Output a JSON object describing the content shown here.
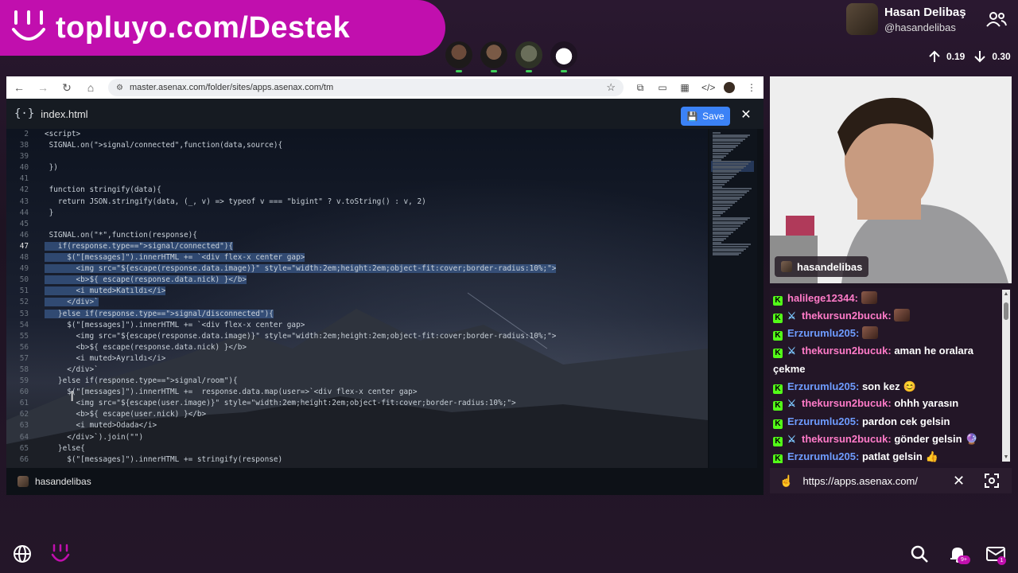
{
  "banner": {
    "text": "topluyo.com/Destek"
  },
  "profile": {
    "name": "Hasan Delibaş",
    "handle": "@hasandelibas"
  },
  "votes": {
    "up": "0.19",
    "down": "0.30"
  },
  "browser": {
    "address": "master.asenax.com/folder/sites/apps.asenax.com/tm",
    "file_name": "index.html",
    "save_label": "Save",
    "bottom_user": "hasandelibas"
  },
  "code_lines": [
    {
      "n": "2",
      "t": "<script>",
      "sel": false
    },
    {
      "n": "38",
      "t": " SIGNAL.on(\">signal/connected\",function(data,source){",
      "sel": false
    },
    {
      "n": "39",
      "t": "",
      "sel": false
    },
    {
      "n": "40",
      "t": " })",
      "sel": false
    },
    {
      "n": "41",
      "t": "",
      "sel": false
    },
    {
      "n": "42",
      "t": " function stringify(data){",
      "sel": false
    },
    {
      "n": "43",
      "t": "   return JSON.stringify(data, (_, v) => typeof v === \"bigint\" ? v.toString() : v, 2)",
      "sel": false
    },
    {
      "n": "44",
      "t": " }",
      "sel": false
    },
    {
      "n": "45",
      "t": "",
      "sel": false
    },
    {
      "n": "46",
      "t": " SIGNAL.on(\"*\",function(response){",
      "sel": false
    },
    {
      "n": "47",
      "t": "   if(response.type==\">signal/connected\"){",
      "sel": true
    },
    {
      "n": "48",
      "t": "     $(\"[messages]\").innerHTML += `<div flex-x center gap>",
      "sel": true
    },
    {
      "n": "49",
      "t": "       <img src=\"${escape(response.data.image)}\" style=\"width:2em;height:2em;object-fit:cover;border-radius:10%;\">",
      "sel": true
    },
    {
      "n": "50",
      "t": "       <b>${ escape(response.data.nick) }</b>",
      "sel": true
    },
    {
      "n": "51",
      "t": "       <i muted>Katıldı</i>",
      "sel": true
    },
    {
      "n": "52",
      "t": "     </div>`",
      "sel": true
    },
    {
      "n": "53",
      "t": "   }else if(response.type==\">signal/disconnected\"){",
      "sel": true
    },
    {
      "n": "54",
      "t": "     $(\"[messages]\").innerHTML += `<div flex-x center gap>",
      "sel": false
    },
    {
      "n": "55",
      "t": "       <img src=\"${escape(response.data.image)}\" style=\"width:2em;height:2em;object-fit:cover;border-radius:10%;\">",
      "sel": false
    },
    {
      "n": "56",
      "t": "       <b>${ escape(response.data.nick) }</b>",
      "sel": false
    },
    {
      "n": "57",
      "t": "       <i muted>Ayrıldı</i>",
      "sel": false
    },
    {
      "n": "58",
      "t": "     </div>`",
      "sel": false
    },
    {
      "n": "59",
      "t": "   }else if(response.type==\">signal/room\"){",
      "sel": false
    },
    {
      "n": "60",
      "t": "     $(\"[messages]\").innerHTML +=  response.data.map(user=>`<div flex-x center gap>",
      "sel": false
    },
    {
      "n": "61",
      "t": "       <img src=\"${escape(user.image)}\" style=\"width:2em;height:2em;object-fit:cover;border-radius:10%;\">",
      "sel": false
    },
    {
      "n": "62",
      "t": "       <b>${ escape(user.nick) }</b>",
      "sel": false
    },
    {
      "n": "63",
      "t": "       <i muted>Odada</i>",
      "sel": false
    },
    {
      "n": "64",
      "t": "     </div>`).join(\"\")",
      "sel": false
    },
    {
      "n": "65",
      "t": "   }else{",
      "sel": false
    },
    {
      "n": "66",
      "t": "     $(\"[messages]\").innerHTML += stringify(response)",
      "sel": false
    }
  ],
  "webcam": {
    "name": "hasandelibas"
  },
  "chat": [
    {
      "user": "halilege12344",
      "color": "pink",
      "sword": false,
      "text": "",
      "emote": true,
      "emoji": ""
    },
    {
      "user": "thekursun2bucuk",
      "color": "pink",
      "sword": true,
      "text": "",
      "emote": true,
      "emoji": ""
    },
    {
      "user": "Erzurumlu205",
      "color": "blue",
      "sword": false,
      "text": "",
      "emote": true,
      "emoji": ""
    },
    {
      "user": "thekursun2bucuk",
      "color": "pink",
      "sword": true,
      "text": "aman he oralara çekme",
      "emote": false,
      "emoji": ""
    },
    {
      "user": "Erzurumlu205",
      "color": "blue",
      "sword": false,
      "text": "son kez",
      "emote": false,
      "emoji": "😊"
    },
    {
      "user": "thekursun2bucuk",
      "color": "pink",
      "sword": true,
      "text": "ohhh yarasın",
      "emote": false,
      "emoji": ""
    },
    {
      "user": "Erzurumlu205",
      "color": "blue",
      "sword": false,
      "text": "pardon cek gelsin",
      "emote": false,
      "emoji": ""
    },
    {
      "user": "thekursun2bucuk",
      "color": "pink",
      "sword": true,
      "text": "gönder gelsin",
      "emote": false,
      "emoji": "🔮"
    },
    {
      "user": "Erzurumlu205",
      "color": "blue",
      "sword": false,
      "text": "patlat gelsin",
      "emote": false,
      "emoji": "👍"
    }
  ],
  "url_bar": {
    "url": "https://apps.asenax.com/"
  },
  "notifications": {
    "badge": "9+",
    "mail_badge": "1"
  },
  "colors": {
    "brand": "#c10fae",
    "kick": "#53fc18",
    "save": "#3b82f6"
  }
}
